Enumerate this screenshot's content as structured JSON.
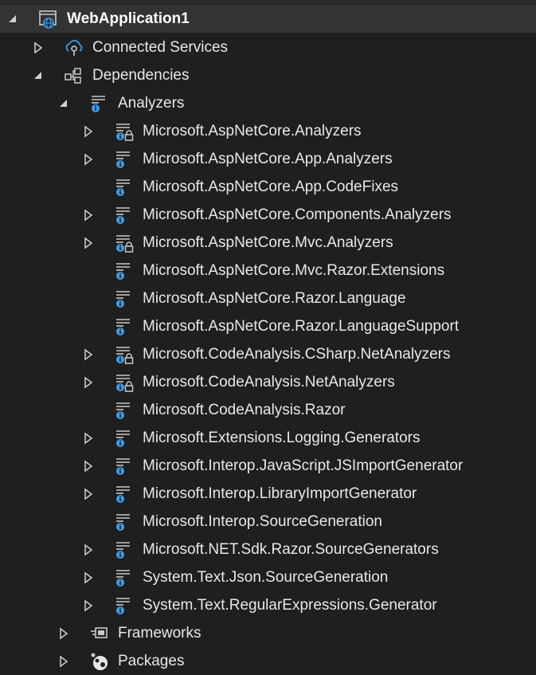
{
  "tree": {
    "root": {
      "label": "WebApplication1",
      "icon": "web-project-icon",
      "expanded": true
    },
    "connected_services": {
      "label": "Connected Services",
      "icon": "cloud-connect-icon",
      "expanded": false
    },
    "dependencies": {
      "label": "Dependencies",
      "icon": "dependencies-icon",
      "expanded": true
    },
    "analyzers": {
      "label": "Analyzers",
      "icon": "analyzer-icon",
      "expanded": true,
      "items": [
        {
          "label": "Microsoft.AspNetCore.Analyzers",
          "expandable": true,
          "icon": "analyzer-locked-icon"
        },
        {
          "label": "Microsoft.AspNetCore.App.Analyzers",
          "expandable": true,
          "icon": "analyzer-icon"
        },
        {
          "label": "Microsoft.AspNetCore.App.CodeFixes",
          "expandable": false,
          "icon": "analyzer-icon"
        },
        {
          "label": "Microsoft.AspNetCore.Components.Analyzers",
          "expandable": true,
          "icon": "analyzer-icon"
        },
        {
          "label": "Microsoft.AspNetCore.Mvc.Analyzers",
          "expandable": true,
          "icon": "analyzer-locked-icon"
        },
        {
          "label": "Microsoft.AspNetCore.Mvc.Razor.Extensions",
          "expandable": false,
          "icon": "analyzer-icon"
        },
        {
          "label": "Microsoft.AspNetCore.Razor.Language",
          "expandable": false,
          "icon": "analyzer-icon"
        },
        {
          "label": "Microsoft.AspNetCore.Razor.LanguageSupport",
          "expandable": false,
          "icon": "analyzer-icon"
        },
        {
          "label": "Microsoft.CodeAnalysis.CSharp.NetAnalyzers",
          "expandable": true,
          "icon": "analyzer-locked-icon"
        },
        {
          "label": "Microsoft.CodeAnalysis.NetAnalyzers",
          "expandable": true,
          "icon": "analyzer-locked-icon"
        },
        {
          "label": "Microsoft.CodeAnalysis.Razor",
          "expandable": false,
          "icon": "analyzer-icon"
        },
        {
          "label": "Microsoft.Extensions.Logging.Generators",
          "expandable": true,
          "icon": "analyzer-icon"
        },
        {
          "label": "Microsoft.Interop.JavaScript.JSImportGenerator",
          "expandable": true,
          "icon": "analyzer-icon"
        },
        {
          "label": "Microsoft.Interop.LibraryImportGenerator",
          "expandable": true,
          "icon": "analyzer-icon"
        },
        {
          "label": "Microsoft.Interop.SourceGeneration",
          "expandable": false,
          "icon": "analyzer-icon"
        },
        {
          "label": "Microsoft.NET.Sdk.Razor.SourceGenerators",
          "expandable": true,
          "icon": "analyzer-icon"
        },
        {
          "label": "System.Text.Json.SourceGeneration",
          "expandable": true,
          "icon": "analyzer-icon"
        },
        {
          "label": "System.Text.RegularExpressions.Generator",
          "expandable": true,
          "icon": "analyzer-icon"
        }
      ]
    },
    "frameworks": {
      "label": "Frameworks",
      "icon": "framework-icon",
      "expanded": false
    },
    "packages": {
      "label": "Packages",
      "icon": "packages-icon",
      "expanded": false
    }
  },
  "colors": {
    "background": "#1f1f1f",
    "selected_row": "#333333",
    "text": "#e8e8e8",
    "icon_blue": "#3c9dea",
    "icon_gray": "#c8c8c8",
    "arrow": "#d0d0d0"
  }
}
